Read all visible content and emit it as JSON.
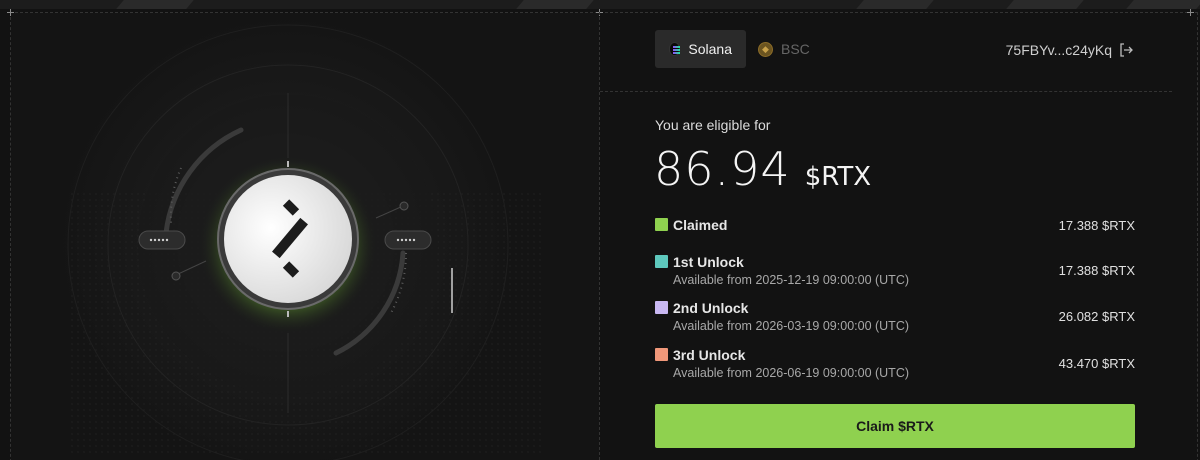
{
  "networks": {
    "active": {
      "label": "Solana",
      "icon": "solana-icon"
    },
    "inactive": {
      "label": "BSC",
      "icon": "bsc-icon"
    }
  },
  "wallet": {
    "address": "75FBYv...c24yKq",
    "icon": "logout-icon"
  },
  "eligibility": {
    "label": "You are eligible for",
    "amount": "86.94",
    "token": "$RTX"
  },
  "schedule": [
    {
      "title": "Claimed",
      "subtitle": "",
      "value": "17.388 $RTX",
      "color": "#8fd14f"
    },
    {
      "title": "1st Unlock",
      "subtitle": "Available from 2025-12-19 09:00:00 (UTC)",
      "value": "17.388 $RTX",
      "color": "#5ec8bd"
    },
    {
      "title": "2nd Unlock",
      "subtitle": "Available from 2026-03-19 09:00:00 (UTC)",
      "value": "26.082 $RTX",
      "color": "#c9b8f2"
    },
    {
      "title": "3rd Unlock",
      "subtitle": "Available from 2026-06-19 09:00:00 (UTC)",
      "value": "43.470 $RTX",
      "color": "#f0987a"
    }
  ],
  "claim_button": {
    "label": "Claim $RTX"
  },
  "colors": {
    "accent": "#8fd14f",
    "background": "#121212",
    "panel_tab": "#2a2a2a"
  }
}
